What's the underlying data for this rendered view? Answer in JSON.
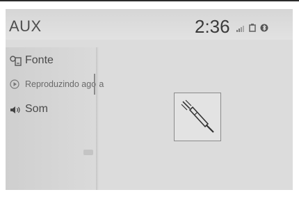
{
  "header": {
    "title": "AUX",
    "clock": "2:36"
  },
  "status_icons": [
    "signal-icon",
    "battery-icon",
    "bluetooth-icon"
  ],
  "sidebar": {
    "items": [
      {
        "label": "Fonte",
        "icon": "source-icon",
        "active": false
      },
      {
        "label": "Reproduzindo agora",
        "icon": "play-icon",
        "active": true
      },
      {
        "label": "Som",
        "icon": "speaker-icon",
        "active": false
      }
    ]
  },
  "main": {
    "icon": "aux-cable-icon"
  },
  "colors": {
    "background": "#dcdcdc",
    "text": "#4a4a4a",
    "frame": "#2a2a2a"
  }
}
